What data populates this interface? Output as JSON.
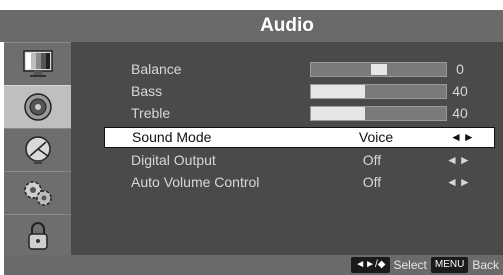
{
  "header": {
    "title": "Audio"
  },
  "sidebar": {
    "items": [
      {
        "name": "picture",
        "icon": "tv-picture-icon",
        "active": false
      },
      {
        "name": "audio",
        "icon": "speaker-icon",
        "active": true
      },
      {
        "name": "channel",
        "icon": "satellite-dish-icon",
        "active": false
      },
      {
        "name": "setup",
        "icon": "gears-icon",
        "active": false
      },
      {
        "name": "lock",
        "icon": "padlock-icon",
        "active": false
      }
    ]
  },
  "audio": {
    "balance": {
      "label": "Balance",
      "value": "0",
      "level": 0.5
    },
    "bass": {
      "label": "Bass",
      "value": "40",
      "level": 0.4
    },
    "treble": {
      "label": "Treble",
      "value": "40",
      "level": 0.4
    },
    "sound_mode": {
      "label": "Sound Mode",
      "value": "Voice",
      "arrows": "◄►"
    },
    "digital_output": {
      "label": "Digital Output",
      "value": "Off",
      "arrows": "◄►"
    },
    "auto_volume": {
      "label": "Auto Volume Control",
      "value": "Off",
      "arrows": "◄►"
    }
  },
  "footer": {
    "nav_key": "◄►/◆",
    "select_label": "Select",
    "menu_key": "MENU",
    "back_label": "Back"
  },
  "colors": {
    "panel": "#4a4a4a",
    "header": "#6a6a6a",
    "highlight": "#ffffff"
  }
}
